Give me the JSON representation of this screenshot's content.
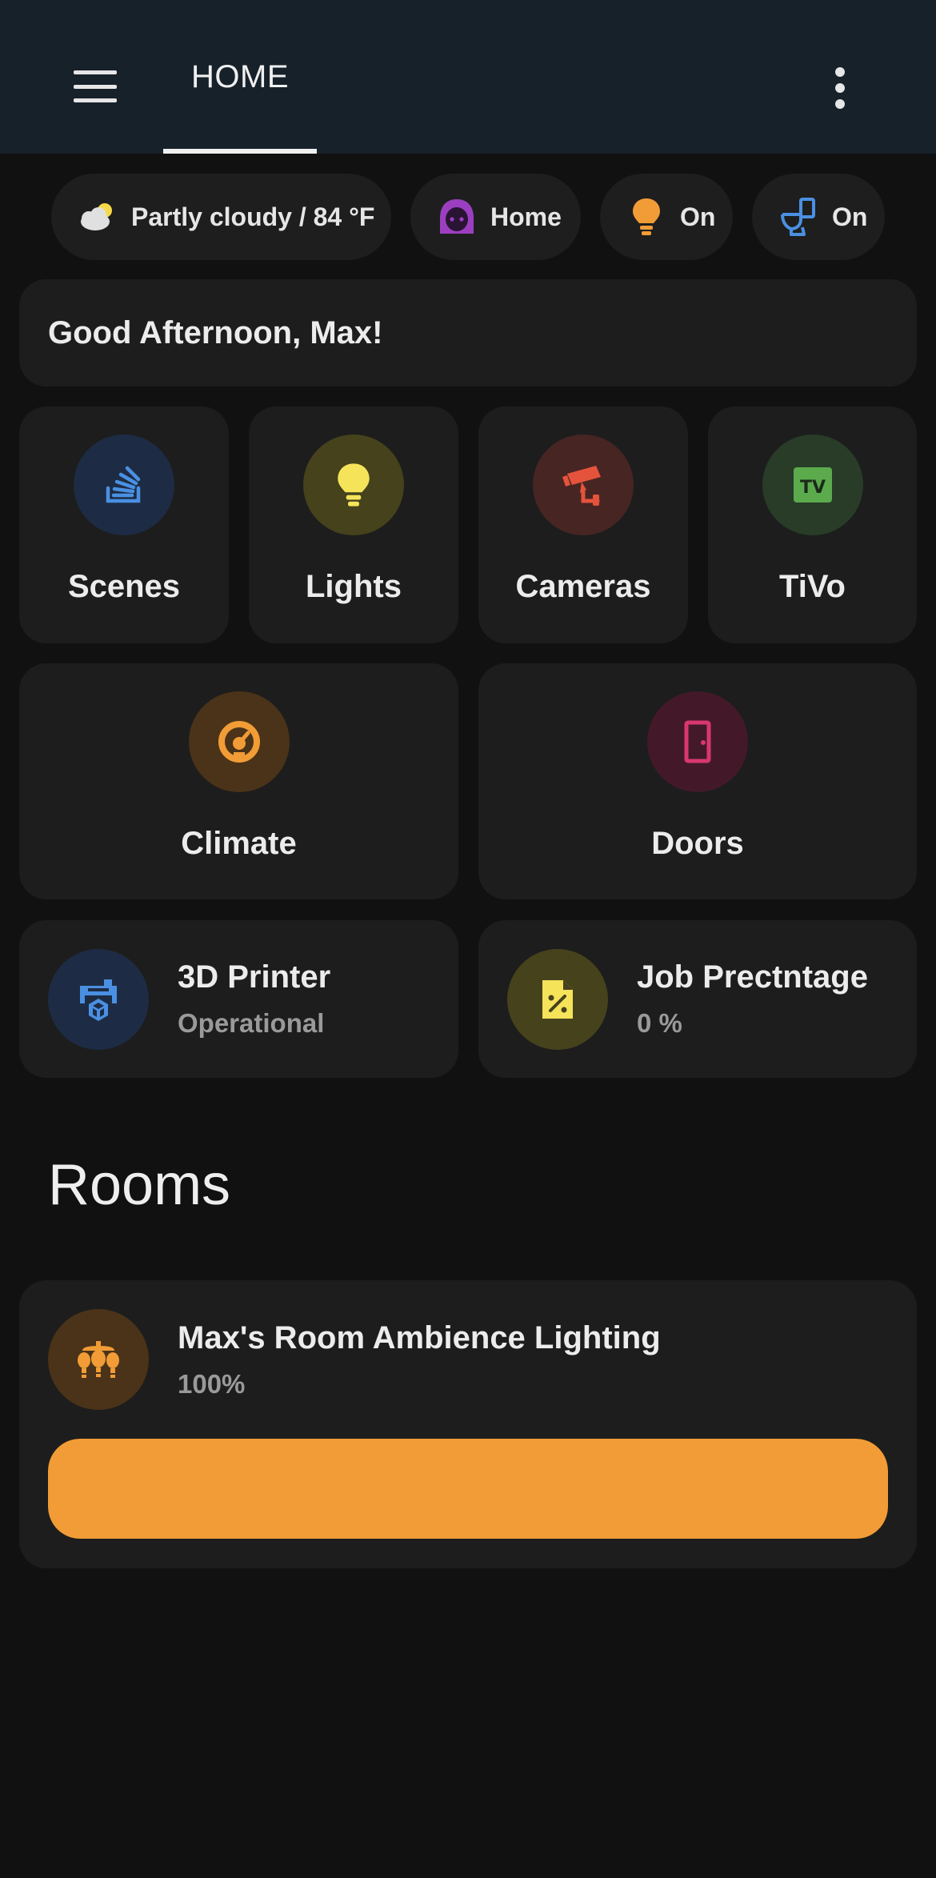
{
  "header": {
    "tab_label": "HOME"
  },
  "chips": {
    "weather": "Partly cloudy / 84 °F",
    "person": "Home",
    "light": "On",
    "toilet": "On"
  },
  "greeting": "Good Afternoon, Max!",
  "tiles": {
    "scenes": "Scenes",
    "lights": "Lights",
    "cameras": "Cameras",
    "tivo": "TiVo",
    "climate": "Climate",
    "doors": "Doors"
  },
  "sensors": {
    "printer_name": "3D Printer",
    "printer_state": "Operational",
    "job_name": "Job Prectntage",
    "job_state": "0 %"
  },
  "rooms": {
    "title": "Rooms",
    "lighting_name": "Max's Room Ambience Lighting",
    "lighting_state": "100%",
    "brightness_percent": 100
  },
  "colors": {
    "accent_orange": "#f19c36",
    "blue": "#4a90e2",
    "yellow": "#f5e35a",
    "red": "#e5533c",
    "green": "#5bab4c",
    "pink": "#d9376e",
    "purple": "#9b3fc0"
  },
  "icons": {
    "menu": "hamburger-icon",
    "more": "more-vertical-icon",
    "weather": "partly-cloudy-icon",
    "person": "face-woman-icon",
    "light": "lightbulb-icon",
    "toilet": "toilet-icon",
    "scenes": "stack-overflow-icon",
    "lights": "lightbulb-icon",
    "cameras": "cctv-icon",
    "tivo": "tv-icon",
    "climate": "thermostat-icon",
    "doors": "door-icon",
    "printer": "printer-3d-icon",
    "job": "file-percent-icon",
    "lighting": "ceiling-light-multiple-icon"
  }
}
